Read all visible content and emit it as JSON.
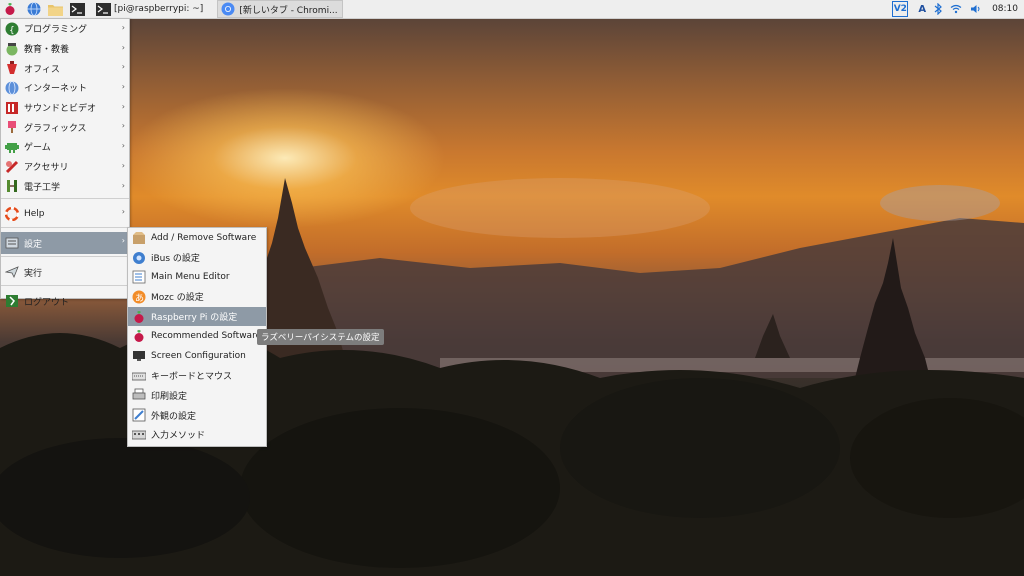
{
  "taskbar": {
    "launchers": [
      {
        "name": "raspberry-menu-button",
        "icon": "raspberry-icon"
      },
      {
        "name": "web-browser-launcher",
        "icon": "globe-icon"
      },
      {
        "name": "file-manager-launcher",
        "icon": "folder-icon"
      },
      {
        "name": "terminal-launcher",
        "icon": "terminal-icon"
      }
    ],
    "tasks": [
      {
        "label": "[pi@raspberrypi: ~]",
        "icon": "terminal-icon"
      },
      {
        "label": "[新しいタブ - Chromi...",
        "icon": "chromium-icon"
      }
    ],
    "tray": {
      "vnc": "V2",
      "input_method": "A",
      "clock": "08:10"
    }
  },
  "main_menu": {
    "items": [
      {
        "label": "プログラミング",
        "icon": "programming-icon",
        "submenu": true
      },
      {
        "label": "教育・教養",
        "icon": "education-icon",
        "submenu": true
      },
      {
        "label": "オフィス",
        "icon": "office-icon",
        "submenu": true
      },
      {
        "label": "インターネット",
        "icon": "internet-icon",
        "submenu": true
      },
      {
        "label": "サウンドとビデオ",
        "icon": "sound-video-icon",
        "submenu": true
      },
      {
        "label": "グラフィックス",
        "icon": "graphics-icon",
        "submenu": true
      },
      {
        "label": "ゲーム",
        "icon": "games-icon",
        "submenu": true
      },
      {
        "label": "アクセサリ",
        "icon": "accessories-icon",
        "submenu": true
      },
      {
        "label": "電子工学",
        "icon": "electronics-icon",
        "submenu": true
      },
      {
        "label": "Help",
        "icon": "help-icon",
        "submenu": true
      },
      {
        "label": "設定",
        "icon": "preferences-icon",
        "submenu": true,
        "selected": true
      },
      {
        "label": "実行",
        "icon": "run-icon",
        "submenu": false
      },
      {
        "label": "ログアウト",
        "icon": "logout-icon",
        "submenu": false
      }
    ]
  },
  "prefs_menu": {
    "items": [
      {
        "label": "Add / Remove Software",
        "icon": "package-icon"
      },
      {
        "label": "iBus の設定",
        "icon": "ibus-icon"
      },
      {
        "label": "Main Menu Editor",
        "icon": "menu-editor-icon"
      },
      {
        "label": "Mozc の設定",
        "icon": "mozc-icon"
      },
      {
        "label": "Raspberry Pi の設定",
        "icon": "raspberry-icon",
        "selected": true
      },
      {
        "label": "Recommended Software",
        "icon": "raspberry-icon"
      },
      {
        "label": "Screen Configuration",
        "icon": "monitor-icon"
      },
      {
        "label": "キーボードとマウス",
        "icon": "keyboard-icon"
      },
      {
        "label": "印刷設定",
        "icon": "printer-icon"
      },
      {
        "label": "外観の設定",
        "icon": "appearance-icon"
      },
      {
        "label": "入力メソッド",
        "icon": "input-method-icon"
      }
    ]
  },
  "tooltip": "ラズベリーパイシステムの設定",
  "colors": {
    "selection": "#8e9aa6",
    "menu_bg": "#f4f4f4",
    "taskbar_bg": "#eeeeee",
    "tray_accent": "#1f6fd1"
  }
}
